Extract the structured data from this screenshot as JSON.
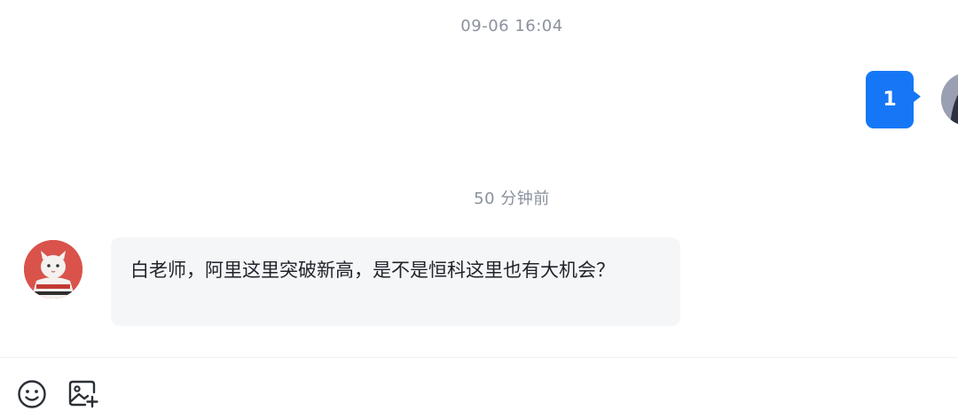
{
  "timestamps": [
    "09-06 16:04",
    "50 分钟前"
  ],
  "outgoing_message": {
    "text": "1",
    "bubble_color": "#1677f6"
  },
  "incoming_message": {
    "text": "白老师，阿里这里突破新高，是不是恒科这里也有大机会？"
  },
  "toolbar": {
    "icons": [
      "emoji-icon",
      "image-add-icon"
    ]
  }
}
